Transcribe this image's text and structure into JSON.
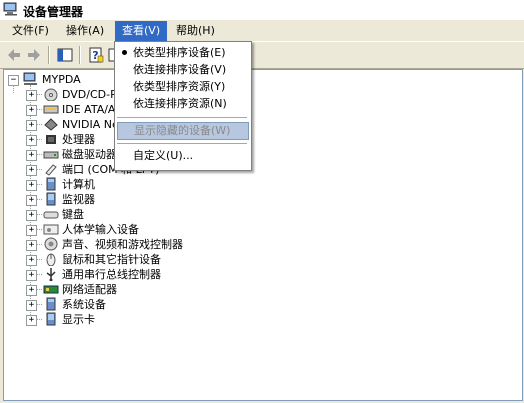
{
  "window": {
    "title": "设备管理器"
  },
  "menubar": {
    "file": "文件(F)",
    "action": "操作(A)",
    "view": "查看(V)",
    "help": "帮助(H)"
  },
  "view_menu": {
    "items": [
      "依类型排序设备(E)",
      "依连接排序设备(V)",
      "依类型排序资源(Y)",
      "依连接排序资源(N)"
    ],
    "checked_index": 0,
    "show_hidden": "显示隐藏的设备(W)",
    "customize": "自定义(U)..."
  },
  "tree": {
    "root": "MYPDA",
    "nodes": [
      "DVD/CD-ROM",
      "IDE ATA/AT",
      "NVIDIA Net",
      "处理器",
      "磁盘驱动器",
      "端口 (COM 和 LPT)",
      "计算机",
      "监视器",
      "键盘",
      "人体学输入设备",
      "声音、视频和游戏控制器",
      "鼠标和其它指针设备",
      "通用串行总线控制器",
      "网络适配器",
      "系统设备",
      "显示卡"
    ]
  },
  "colors": {
    "menu_highlight": "#316ac5",
    "dropdown_hover": "#b8c7e0",
    "tree_border": "#7f9db9"
  }
}
